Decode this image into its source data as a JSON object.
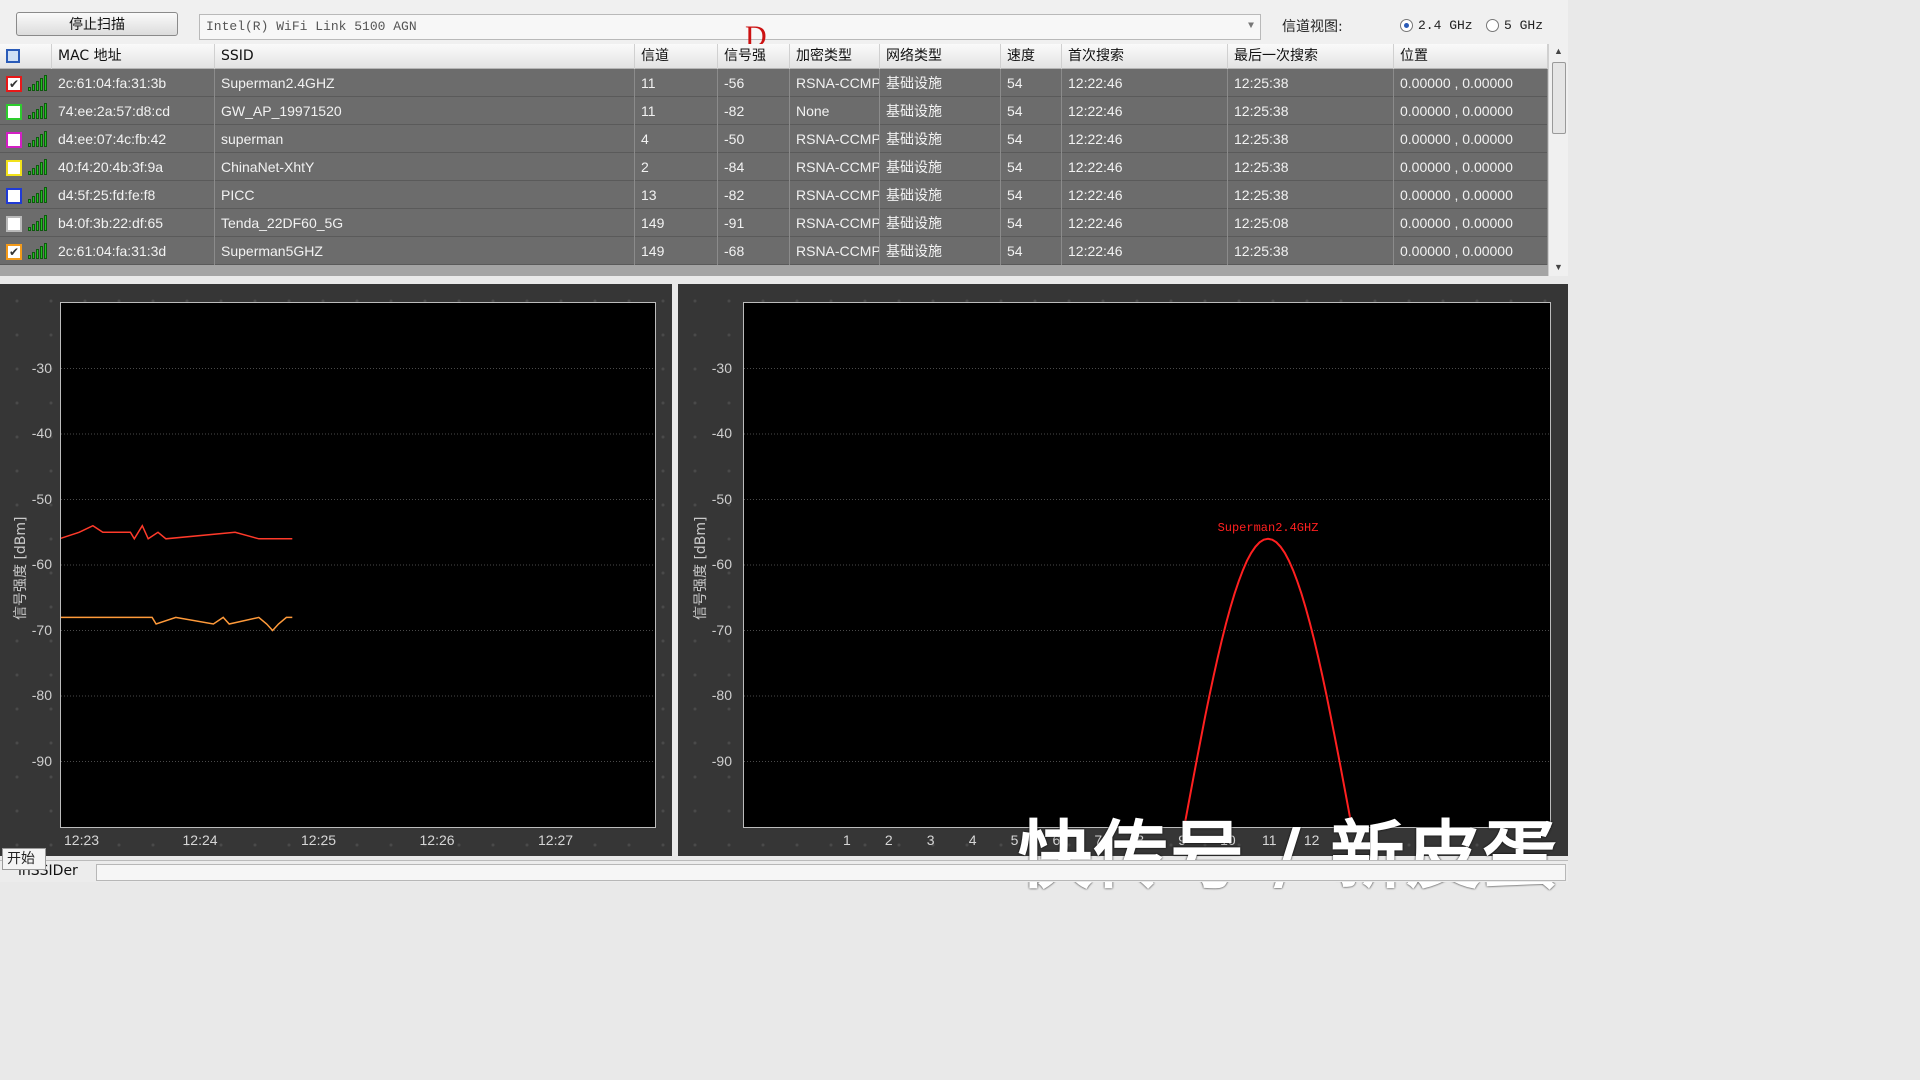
{
  "toolbar": {
    "stop_scan_label": "停止扫描",
    "adapter_value": "Intel(R) WiFi Link 5100 AGN",
    "channel_view_label": "信道视图:",
    "band_options": [
      {
        "label": "2.4 GHz",
        "selected": true
      },
      {
        "label": "5 GHz",
        "selected": false
      }
    ],
    "cursor_glyph": "D"
  },
  "table": {
    "columns": [
      "MAC 地址",
      "SSID",
      "信道",
      "信号强",
      "加密类型",
      "网络类型",
      "速度",
      "首次搜索",
      "最后一次搜索",
      "位置"
    ],
    "rows": [
      {
        "color": "#e81818",
        "checked": true,
        "mac": "2c:61:04:fa:31:3b",
        "ssid": "Superman2.4GHZ",
        "channel": "11",
        "rssi": "-56",
        "security": "RSNA-CCMP",
        "network": "基础设施",
        "speed": "54",
        "first_seen": "12:22:46",
        "last_seen": "12:25:38",
        "location": "0.00000 , 0.00000"
      },
      {
        "color": "#2ecc2e",
        "checked": false,
        "mac": "74:ee:2a:57:d8:cd",
        "ssid": "GW_AP_19971520",
        "channel": "11",
        "rssi": "-82",
        "security": "None",
        "network": "基础设施",
        "speed": "54",
        "first_seen": "12:22:46",
        "last_seen": "12:25:38",
        "location": "0.00000 , 0.00000"
      },
      {
        "color": "#d21fc4",
        "checked": false,
        "mac": "d4:ee:07:4c:fb:42",
        "ssid": "superman",
        "channel": "4",
        "rssi": "-50",
        "security": "RSNA-CCMP",
        "network": "基础设施",
        "speed": "54",
        "first_seen": "12:22:46",
        "last_seen": "12:25:38",
        "location": "0.00000 , 0.00000"
      },
      {
        "color": "#f2e21a",
        "checked": false,
        "mac": "40:f4:20:4b:3f:9a",
        "ssid": "ChinaNet-XhtY",
        "channel": "2",
        "rssi": "-84",
        "security": "RSNA-CCMP",
        "network": "基础设施",
        "speed": "54",
        "first_seen": "12:22:46",
        "last_seen": "12:25:38",
        "location": "0.00000 , 0.00000"
      },
      {
        "color": "#1f3ad6",
        "checked": false,
        "mac": "d4:5f:25:fd:fe:f8",
        "ssid": "PICC",
        "channel": "13",
        "rssi": "-82",
        "security": "RSNA-CCMP",
        "network": "基础设施",
        "speed": "54",
        "first_seen": "12:22:46",
        "last_seen": "12:25:38",
        "location": "0.00000 , 0.00000"
      },
      {
        "color": "#b9b9b9",
        "checked": false,
        "mac": "b4:0f:3b:22:df:65",
        "ssid": "Tenda_22DF60_5G",
        "channel": "149",
        "rssi": "-91",
        "security": "RSNA-CCMP",
        "network": "基础设施",
        "speed": "54",
        "first_seen": "12:22:46",
        "last_seen": "12:25:08",
        "location": "0.00000 , 0.00000"
      },
      {
        "color": "#f39a1a",
        "checked": true,
        "mac": "2c:61:04:fa:31:3d",
        "ssid": "Superman5GHZ",
        "channel": "149",
        "rssi": "-68",
        "security": "RSNA-CCMP",
        "network": "基础设施",
        "speed": "54",
        "first_seen": "12:22:46",
        "last_seen": "12:25:38",
        "location": "0.00000 , 0.00000"
      }
    ]
  },
  "time_chart": {
    "yaxis_title": "信号强度 [dBm]",
    "yticks": [
      "-30",
      "-40",
      "-50",
      "-60",
      "-70",
      "-80",
      "-90"
    ],
    "xticks": [
      "12:23",
      "12:24",
      "12:25",
      "12:26",
      "12:27"
    ]
  },
  "channel_chart": {
    "yaxis_title": "信号强度 [dBm]",
    "yticks": [
      "-30",
      "-40",
      "-50",
      "-60",
      "-70",
      "-80",
      "-90"
    ],
    "xticks": [
      "1",
      "2",
      "3",
      "4",
      "5",
      "6",
      "7",
      "8",
      "9",
      "10",
      "11",
      "12"
    ],
    "peak_label": "Superman2.4GHZ"
  },
  "chart_data": [
    {
      "type": "line",
      "xlabel": "",
      "ylabel": "信号强度 [dBm]",
      "ylim": [
        -20,
        -100
      ],
      "x_ticks": [
        "12:23",
        "12:24",
        "12:25",
        "12:26",
        "12:27"
      ],
      "grid": true,
      "series": [
        {
          "color": "#ff3a2a",
          "points": [
            [
              "12:22:46",
              -55
            ],
            [
              "12:22:48",
              -56
            ],
            [
              "12:22:58",
              -55
            ],
            [
              "12:23:05",
              -54
            ],
            [
              "12:23:10",
              -55
            ],
            [
              "12:23:24",
              -55
            ],
            [
              "12:23:26",
              -56
            ],
            [
              "12:23:30",
              -54
            ],
            [
              "12:23:33",
              -56
            ],
            [
              "12:23:38",
              -55
            ],
            [
              "12:23:42",
              -56
            ],
            [
              "12:24:17",
              -55
            ],
            [
              "12:24:29",
              -56
            ],
            [
              "12:24:46",
              -56
            ]
          ]
        },
        {
          "color": "#ff9a3a",
          "points": [
            [
              "12:22:46",
              -68
            ],
            [
              "12:23:35",
              -68
            ],
            [
              "12:23:37",
              -69
            ],
            [
              "12:23:47",
              -68
            ],
            [
              "12:24:06",
              -69
            ],
            [
              "12:24:11",
              -68
            ],
            [
              "12:24:14",
              -69
            ],
            [
              "12:24:29",
              -68
            ],
            [
              "12:24:33",
              -69
            ],
            [
              "12:24:36",
              -70
            ],
            [
              "12:24:39",
              -69
            ],
            [
              "12:24:43",
              -68
            ],
            [
              "12:24:46",
              -68
            ]
          ]
        }
      ]
    },
    {
      "type": "area",
      "xlabel": "",
      "ylabel": "信号强度 [dBm]",
      "ylim": [
        -20,
        -100
      ],
      "x": [
        1,
        2,
        3,
        4,
        5,
        6,
        7,
        8,
        9,
        10,
        11,
        12
      ],
      "grid": true,
      "series": [
        {
          "name": "Superman2.4GHZ",
          "color": "#ff2020",
          "channel": 11,
          "peak": -56,
          "floor": -100,
          "span": [
            9,
            13
          ]
        }
      ]
    }
  ],
  "watermark": "快传号 / 新皮蛋",
  "status": {
    "app_name": "inSSIDer",
    "start_label": "开始"
  }
}
